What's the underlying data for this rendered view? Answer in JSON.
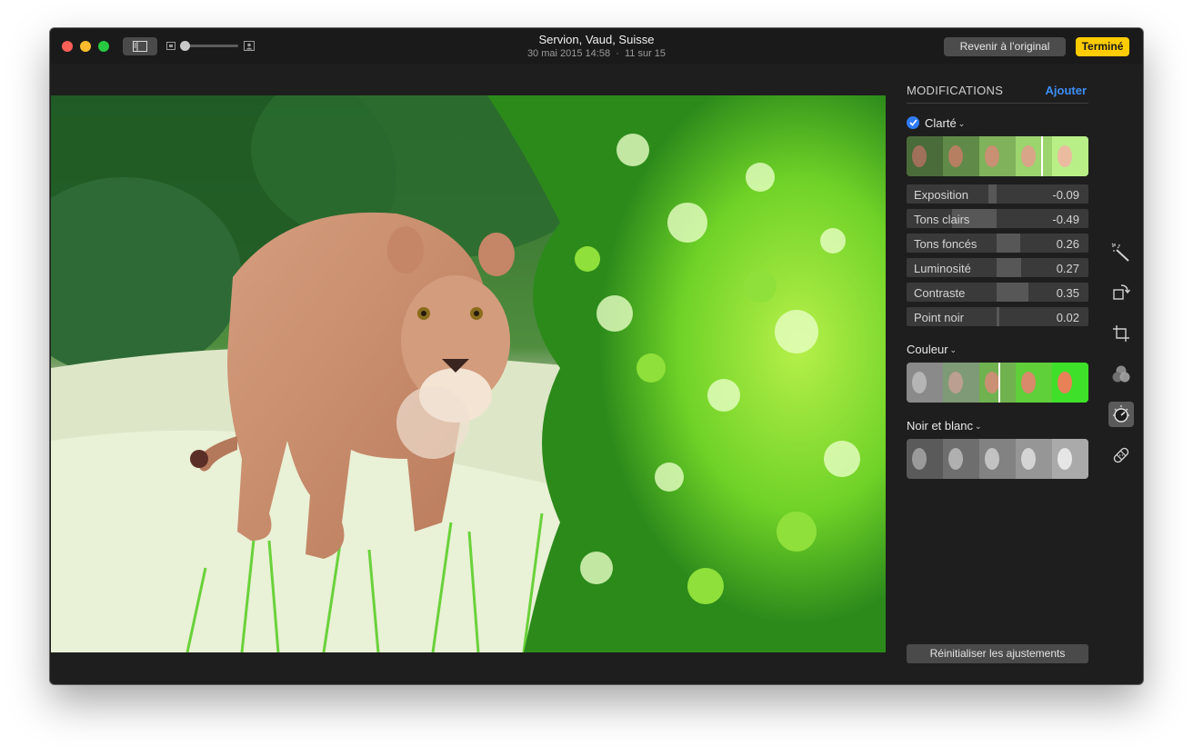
{
  "window": {
    "title": "Servion, Vaud, Suisse",
    "subtitle_date": "30 mai 2015 14:58",
    "subtitle_sep": "·",
    "subtitle_count": "11 sur 15"
  },
  "toolbar": {
    "revert_label": "Revenir à l’original",
    "done_label": "Terminé",
    "zoom_level": 0.0
  },
  "adjust_panel": {
    "title": "MODIFICATIONS",
    "add_label": "Ajouter",
    "sections": {
      "clarity": {
        "label": "Clarté",
        "enabled": true
      },
      "color": {
        "label": "Couleur"
      },
      "bw": {
        "label": "Noir et blanc"
      }
    },
    "sliders": [
      {
        "label": "Exposition",
        "value": "-0.09"
      },
      {
        "label": "Tons clairs",
        "value": "-0.49"
      },
      {
        "label": "Tons foncés",
        "value": "0.26"
      },
      {
        "label": "Luminosité",
        "value": "0.27"
      },
      {
        "label": "Contraste",
        "value": "0.35"
      },
      {
        "label": "Point noir",
        "value": "0.02"
      }
    ],
    "reset_label": "Réinitialiser les ajustements"
  },
  "tools": [
    "magic-wand-icon",
    "rotate-icon",
    "crop-icon",
    "filters-icon",
    "adjust-icon",
    "retouch-icon"
  ],
  "colors": {
    "accent": "#3e8ef7",
    "done": "#ffcc00",
    "background": "#1e1e1e"
  }
}
